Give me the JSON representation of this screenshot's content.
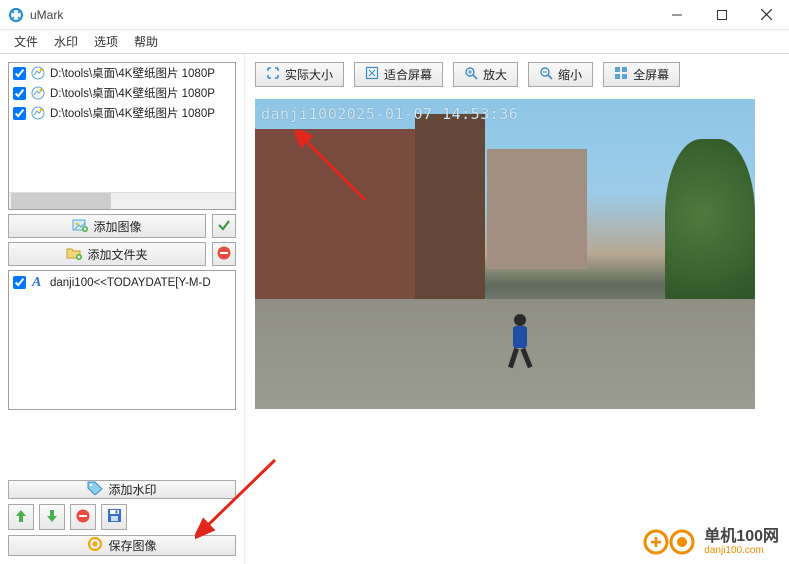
{
  "app": {
    "title": "uMark"
  },
  "menu": {
    "file": "文件",
    "watermark": "水印",
    "options": "选项",
    "help": "帮助"
  },
  "files": {
    "items": [
      {
        "path": "D:\\tools\\桌面\\4K壁纸图片 1080P"
      },
      {
        "path": "D:\\tools\\桌面\\4K壁纸图片 1080P"
      },
      {
        "path": "D:\\tools\\桌面\\4K壁纸图片 1080P"
      }
    ]
  },
  "left": {
    "add_image": "添加图像",
    "add_folder": "添加文件夹",
    "add_watermark": "添加水印",
    "save_image": "保存图像"
  },
  "watermarks": {
    "items": [
      {
        "text": "danji100<<TODAYDATE[Y-M-D"
      }
    ]
  },
  "toolbar": {
    "actual_size": "实际大小",
    "fit_screen": "适合屏幕",
    "zoom_in": "放大",
    "zoom_out": "缩小",
    "fullscreen": "全屏幕"
  },
  "preview": {
    "watermark_text": "danji1002025-01-07 14:53:36"
  },
  "brand": {
    "name": "单机100网",
    "domain": "danji100.com"
  }
}
